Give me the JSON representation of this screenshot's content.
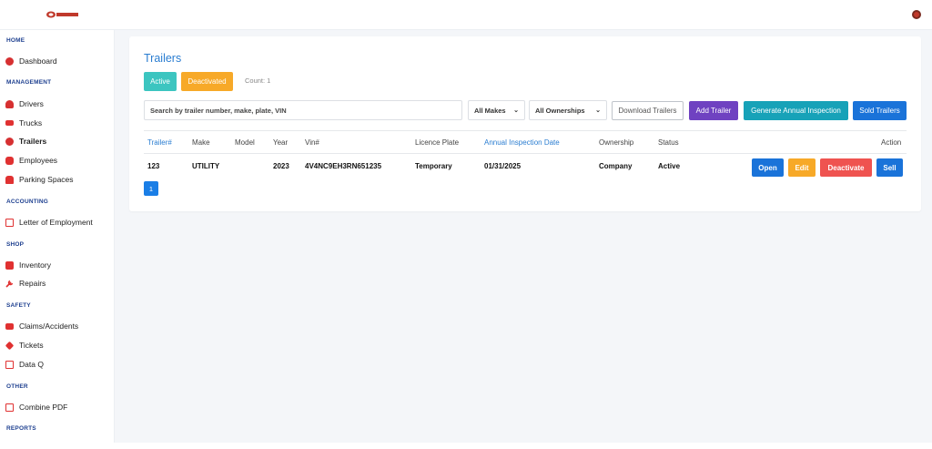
{
  "sidebar": {
    "sections": [
      {
        "title": "HOME",
        "items": [
          {
            "label": "Dashboard",
            "icon": "dashboard-icon"
          }
        ]
      },
      {
        "title": "MANAGEMENT",
        "items": [
          {
            "label": "Drivers",
            "icon": "driver-icon"
          },
          {
            "label": "Trucks",
            "icon": "truck-icon"
          },
          {
            "label": "Trailers",
            "icon": "trailer-icon"
          },
          {
            "label": "Employees",
            "icon": "employees-icon"
          },
          {
            "label": "Parking Spaces",
            "icon": "car-icon"
          }
        ]
      },
      {
        "title": "ACCOUNTING",
        "items": [
          {
            "label": "Letter of Employment",
            "icon": "document-icon"
          }
        ]
      },
      {
        "title": "SHOP",
        "items": [
          {
            "label": "Inventory",
            "icon": "inventory-icon"
          },
          {
            "label": "Repairs",
            "icon": "wrench-icon"
          }
        ]
      },
      {
        "title": "SAFETY",
        "items": [
          {
            "label": "Claims/Accidents",
            "icon": "ambulance-icon"
          },
          {
            "label": "Tickets",
            "icon": "ticket-icon"
          },
          {
            "label": "Data Q",
            "icon": "document-icon"
          }
        ]
      },
      {
        "title": "OTHER",
        "items": [
          {
            "label": "Combine PDF",
            "icon": "pdf-icon"
          }
        ]
      },
      {
        "title": "REPORTS",
        "items": []
      }
    ]
  },
  "main": {
    "title": "Trailers",
    "status_tabs": {
      "active": "Active",
      "deactivated": "Deactivated"
    },
    "count_label": "Count: 1",
    "search": {
      "placeholder": "Search by trailer number, make, plate, VIN"
    },
    "filters": {
      "makes": "All Makes",
      "ownerships": "All Ownerships"
    },
    "actions": {
      "download": "Download Trailers",
      "add": "Add Trailer",
      "generate": "Generate Annual Inspection",
      "sold": "Sold Trailers"
    },
    "table": {
      "headers": [
        "Trailer#",
        "Make",
        "Model",
        "Year",
        "Vin#",
        "Licence Plate",
        "Annual Inspection Date",
        "Ownership",
        "Status",
        "Action"
      ],
      "rows": [
        {
          "trailer": "123",
          "make": "UTILITY",
          "model": "",
          "year": "2023",
          "vin": "4V4NC9EH3RN651235",
          "plate": "Temporary",
          "inspection": "01/31/2025",
          "ownership": "Company",
          "status": "Active"
        }
      ],
      "row_actions": {
        "open": "Open",
        "edit": "Edit",
        "deactivate": "Deactivate",
        "sell": "Sell"
      }
    },
    "pagination": {
      "current": "1"
    }
  },
  "colors": {
    "accent_blue": "#2a7dd1",
    "teal": "#3cc5c0",
    "orange": "#f7a928",
    "purple": "#6f42c1",
    "cyan": "#17a2b8",
    "primary": "#1a73d9",
    "danger": "#ef5350"
  }
}
